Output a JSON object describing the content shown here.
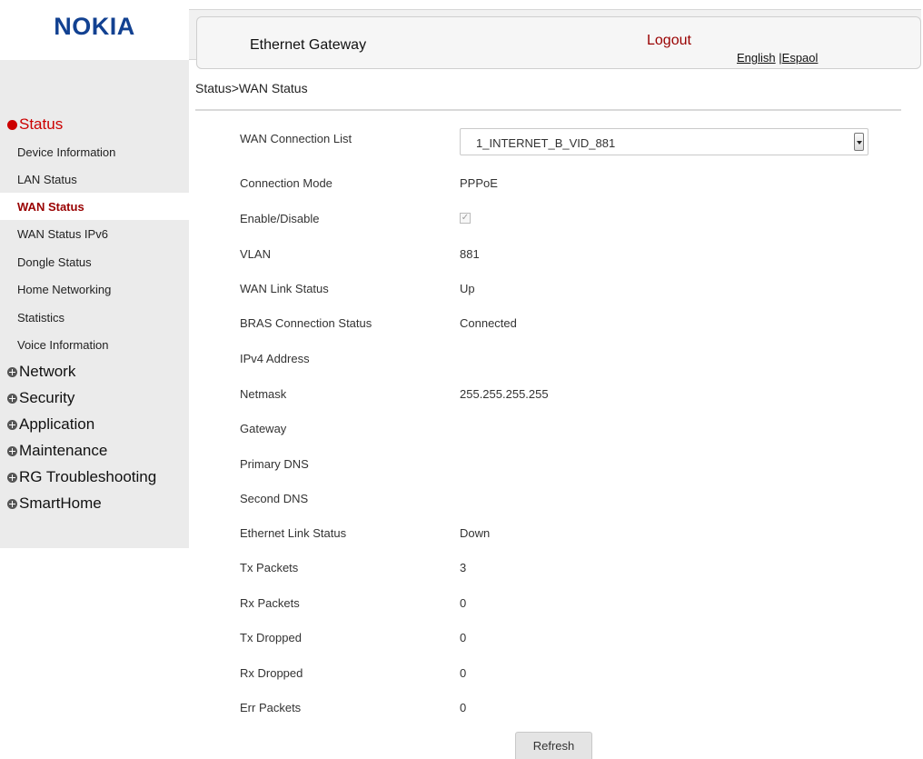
{
  "brand": {
    "logo_text": "NOKIA"
  },
  "header": {
    "title": "Ethernet Gateway",
    "logout": "Logout",
    "lang_english": "English",
    "lang_sep": "|",
    "lang_espanol": "Espaol"
  },
  "breadcrumb": "Status>WAN Status",
  "sidebar": {
    "status_section": "Status",
    "status_items": [
      "Device Information",
      "LAN Status",
      "WAN Status",
      "WAN Status IPv6",
      "Dongle Status",
      "Home Networking",
      "Statistics",
      "Voice Information"
    ],
    "selected_item": "WAN Status",
    "other_sections": [
      "Network",
      "Security",
      "Application",
      "Maintenance",
      "RG Troubleshooting",
      "SmartHome"
    ]
  },
  "wan": {
    "connection_list_label": "WAN Connection List",
    "connection_list_value": "1_INTERNET_B_VID_881",
    "rows": [
      {
        "label": "Connection Mode",
        "value": "PPPoE"
      },
      {
        "label": "Enable/Disable",
        "value": ""
      },
      {
        "label": "VLAN",
        "value": "881"
      },
      {
        "label": "WAN Link Status",
        "value": "Up"
      },
      {
        "label": "BRAS Connection Status",
        "value": "Connected"
      },
      {
        "label": "IPv4 Address",
        "value": ""
      },
      {
        "label": "Netmask",
        "value": "255.255.255.255"
      },
      {
        "label": "Gateway",
        "value": ""
      },
      {
        "label": "Primary DNS",
        "value": ""
      },
      {
        "label": "Second DNS",
        "value": ""
      },
      {
        "label": "Ethernet Link Status",
        "value": "Down"
      },
      {
        "label": "Tx Packets",
        "value": "3"
      },
      {
        "label": "Rx Packets",
        "value": "0"
      },
      {
        "label": "Tx Dropped",
        "value": "0"
      },
      {
        "label": "Rx Dropped",
        "value": "0"
      },
      {
        "label": "Err Packets",
        "value": "0"
      }
    ],
    "enable_checked": true,
    "refresh_label": "Refresh"
  }
}
